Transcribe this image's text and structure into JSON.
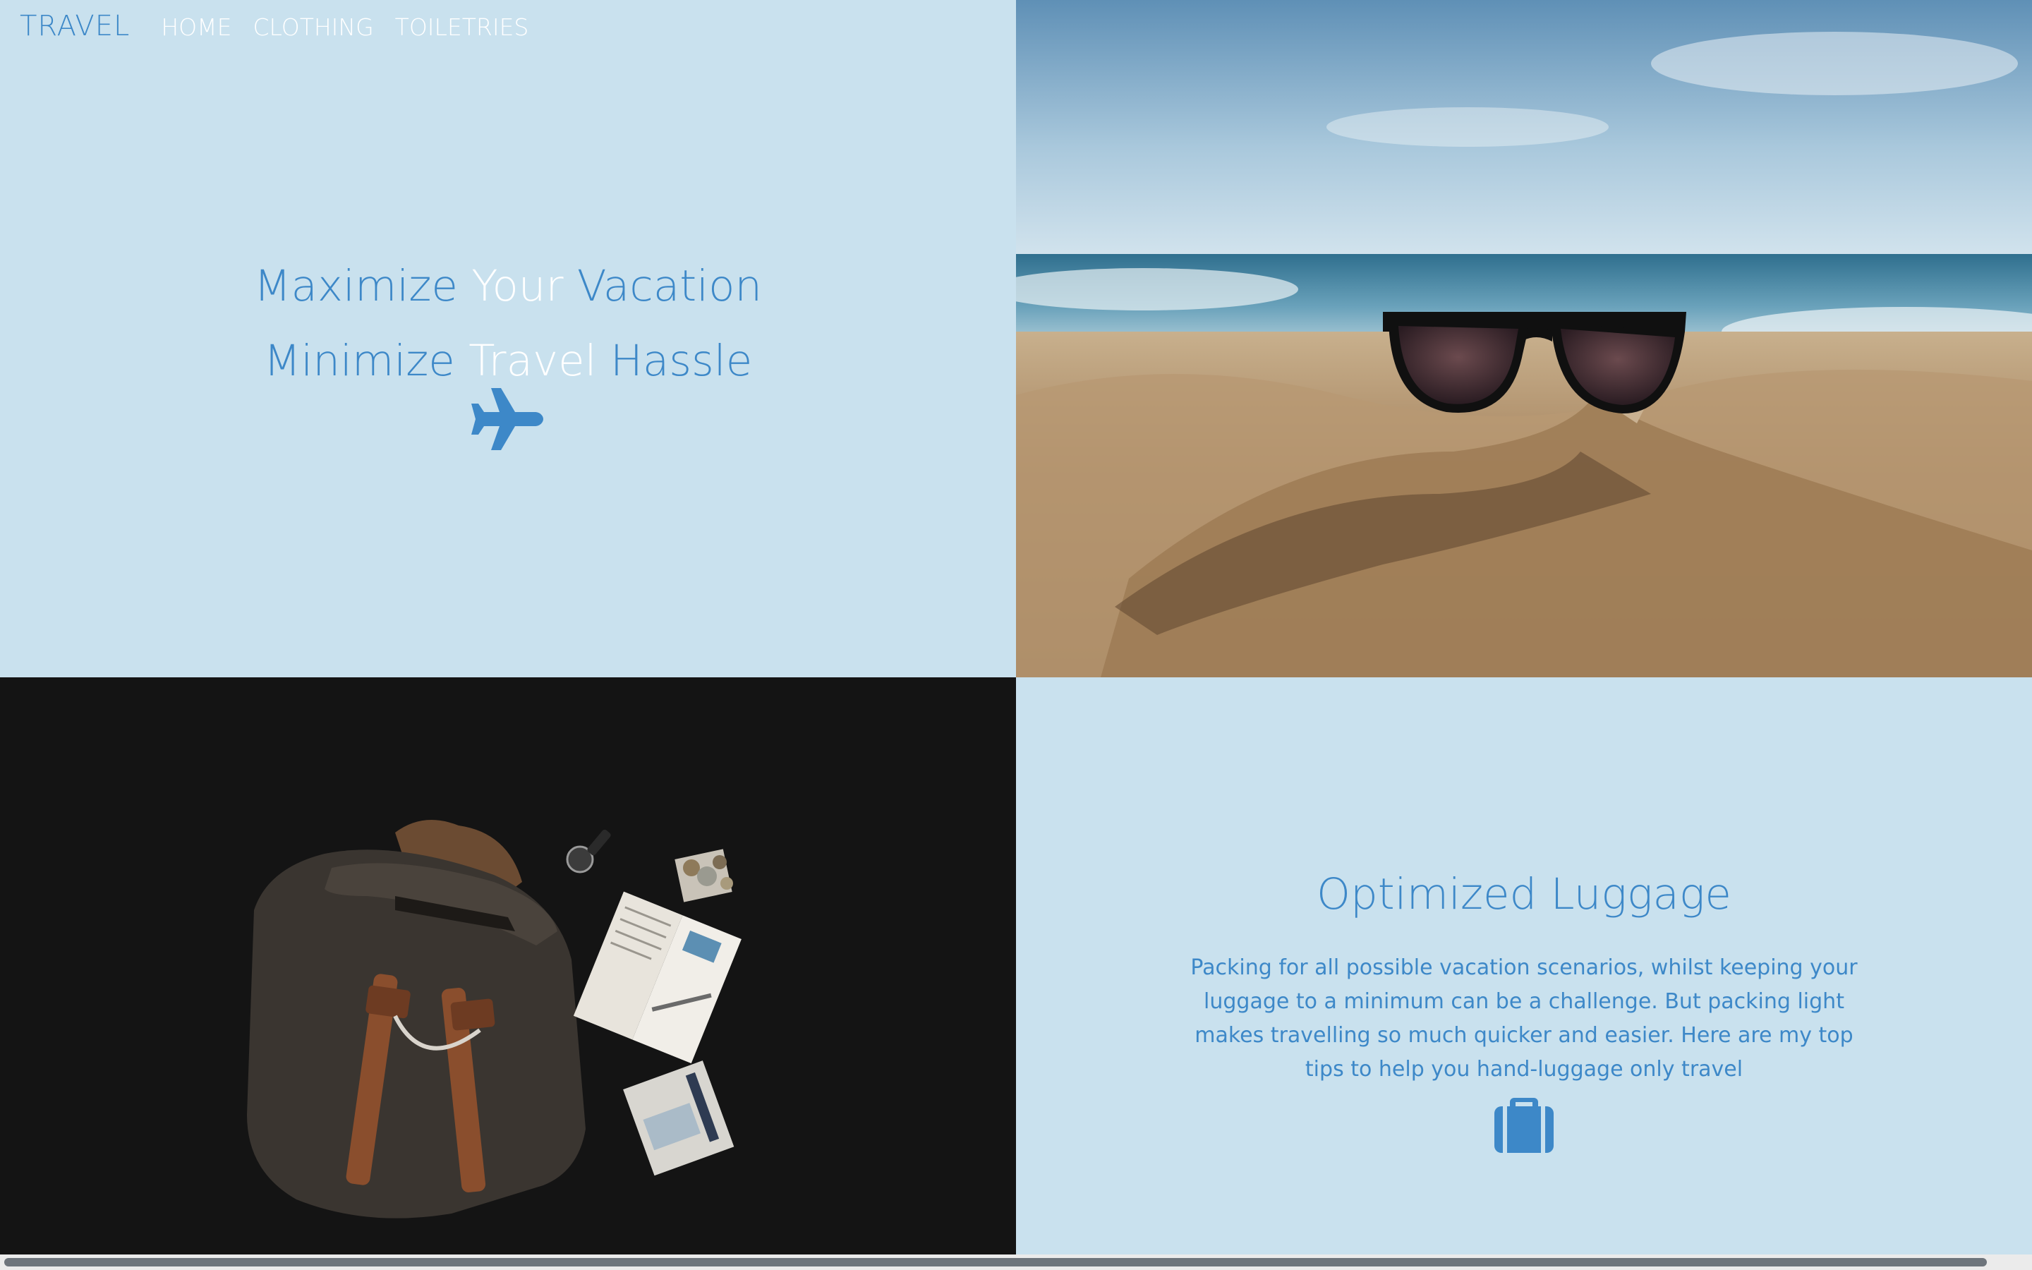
{
  "nav": {
    "brand": "TRAVEL",
    "links": [
      "HOME",
      "CLOTHING",
      "TOILETRIES"
    ]
  },
  "hero": {
    "line1": [
      "Maximize",
      "Your",
      "Vacation"
    ],
    "line2": [
      "Minimize",
      "Travel",
      "Hassle"
    ],
    "icon": "plane-icon"
  },
  "luggage": {
    "title": "Optimized Luggage",
    "text": "Packing for all possible vacation scenarios, whilst keeping your luggage to a minimum can be a challenge. But packing light makes travelling so much quicker and easier. Here are my top tips to help you hand-luggage only travel",
    "icon": "suitcase-icon"
  },
  "colors": {
    "accent": "#3d88c8",
    "panel_bg": "#c9e1ee",
    "dark_bg": "#141414"
  }
}
